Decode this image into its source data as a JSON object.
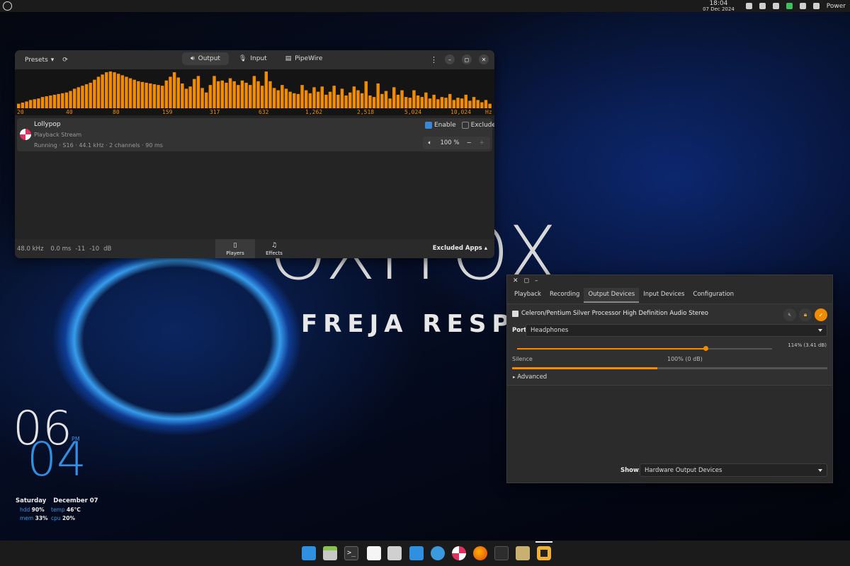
{
  "topbar": {
    "time": "18:04",
    "date": "07 Dec 2024",
    "power_label": "Power"
  },
  "easyeffects": {
    "presets_label": "Presets",
    "tabs": [
      {
        "label": "Output"
      },
      {
        "label": "Input"
      },
      {
        "label": "PipeWire"
      }
    ],
    "spectrum": {
      "freq_labels": [
        "20",
        "40",
        "80",
        "159",
        "317",
        "632",
        "1,262",
        "2,518",
        "5,024",
        "10,024",
        "Hz"
      ],
      "bar_color": "#f08c00",
      "levels": [
        0.12,
        0.15,
        0.18,
        0.22,
        0.24,
        0.26,
        0.3,
        0.32,
        0.34,
        0.36,
        0.38,
        0.4,
        0.42,
        0.46,
        0.52,
        0.56,
        0.6,
        0.64,
        0.68,
        0.76,
        0.84,
        0.9,
        0.96,
        0.98,
        0.96,
        0.92,
        0.88,
        0.84,
        0.8,
        0.76,
        0.72,
        0.7,
        0.68,
        0.66,
        0.64,
        0.62,
        0.6,
        0.74,
        0.84,
        0.96,
        0.82,
        0.66,
        0.52,
        0.58,
        0.78,
        0.86,
        0.54,
        0.42,
        0.62,
        0.86,
        0.72,
        0.74,
        0.68,
        0.8,
        0.72,
        0.62,
        0.74,
        0.68,
        0.62,
        0.86,
        0.72,
        0.6,
        0.98,
        0.72,
        0.54,
        0.48,
        0.62,
        0.52,
        0.44,
        0.4,
        0.38,
        0.62,
        0.48,
        0.4,
        0.56,
        0.44,
        0.58,
        0.36,
        0.44,
        0.6,
        0.36,
        0.52,
        0.34,
        0.42,
        0.58,
        0.48,
        0.4,
        0.72,
        0.34,
        0.3,
        0.66,
        0.38,
        0.46,
        0.26,
        0.56,
        0.36,
        0.48,
        0.3,
        0.28,
        0.48,
        0.34,
        0.3,
        0.42,
        0.26,
        0.36,
        0.24,
        0.3,
        0.28,
        0.38,
        0.22,
        0.28,
        0.26,
        0.36,
        0.2,
        0.3,
        0.22,
        0.16,
        0.22,
        0.12
      ]
    },
    "stream": {
      "app_name": "Lollypop",
      "type": "Playback Stream",
      "details": [
        "Running",
        "S16",
        "44.1 kHz",
        "2 channels",
        "90 ms"
      ],
      "enable_label": "Enable",
      "enable_checked": true,
      "exclude_label": "Exclude",
      "exclude_checked": false,
      "volume": "100 %"
    },
    "footer": {
      "stats": [
        "48.0 kHz",
        "0.0 ms",
        "-11",
        "-10",
        "dB"
      ],
      "players_label": "Players",
      "effects_label": "Effects",
      "excluded_apps_label": "Excluded Apps"
    }
  },
  "pavucontrol": {
    "tabs": [
      "Playback",
      "Recording",
      "Output Devices",
      "Input Devices",
      "Configuration"
    ],
    "active_tab": "Output Devices",
    "device_name": "Celeron/Pentium Silver Processor High Definition Audio Stereo",
    "port_label": "Port:",
    "port_value": "Headphones",
    "volume_readout": "114% (3.41 dB)",
    "volume_fraction": 0.74,
    "silence_label": "Silence",
    "base_label": "100% (0 dB)",
    "peak_fraction": 0.46,
    "advanced_label": "Advanced",
    "show_label": "Show:",
    "show_value": "Hardware Output Devices",
    "accent": "#f08c00"
  },
  "desktop": {
    "hour": "06",
    "minute": "04",
    "ampm": "PM",
    "day": "Saturday",
    "date": "December 07",
    "stats": [
      {
        "label": "hdd",
        "value": "90%"
      },
      {
        "label": "temp",
        "value": "46°C"
      },
      {
        "label": "mem",
        "value": "33%"
      },
      {
        "label": "cpu",
        "value": "20%"
      }
    ],
    "wallpaper_text_large": "OXITOX",
    "wallpaper_text": "FREJA RESP"
  }
}
